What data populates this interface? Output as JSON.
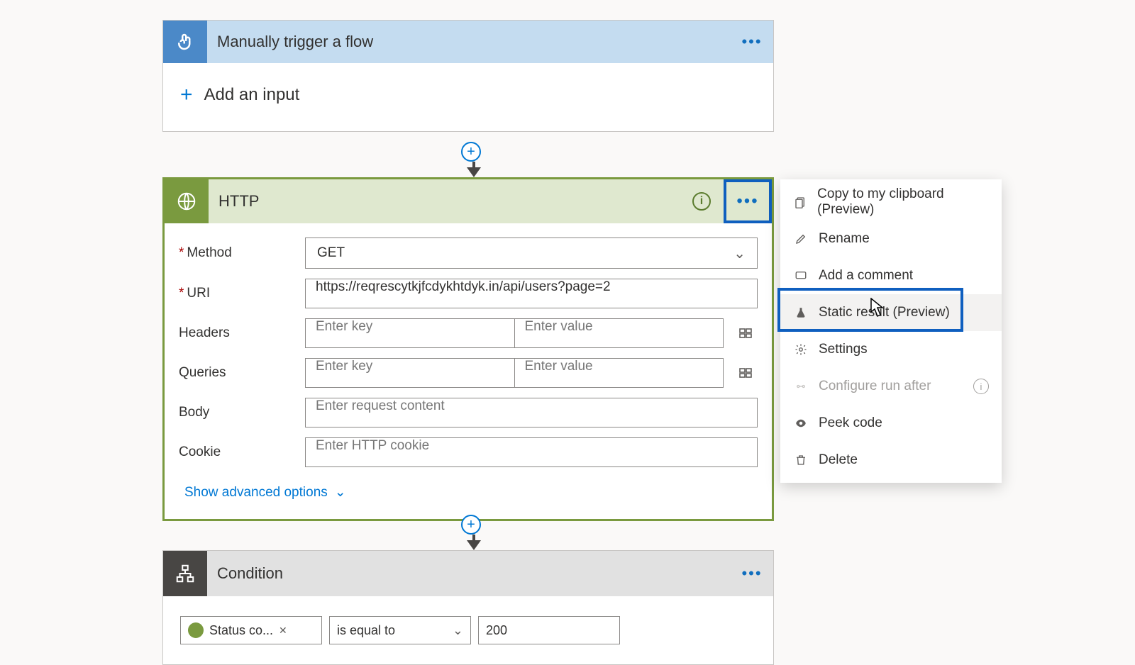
{
  "trigger": {
    "title": "Manually trigger a flow",
    "add_input_label": "Add an input"
  },
  "http": {
    "title": "HTTP",
    "labels": {
      "method": "Method",
      "uri": "URI",
      "headers": "Headers",
      "queries": "Queries",
      "body": "Body",
      "cookie": "Cookie"
    },
    "method_value": "GET",
    "uri_value": "https://reqrescytkjfcdykhtdyk.in/api/users?page=2",
    "placeholders": {
      "key": "Enter key",
      "value": "Enter value",
      "body": "Enter request content",
      "cookie": "Enter HTTP cookie"
    },
    "advanced_label": "Show advanced options"
  },
  "condition": {
    "title": "Condition",
    "field_token": "Status co...",
    "operator": "is equal to",
    "value": "200"
  },
  "menu": {
    "copy": "Copy to my clipboard (Preview)",
    "rename": "Rename",
    "comment": "Add a comment",
    "static_result": "Static result (Preview)",
    "settings": "Settings",
    "run_after": "Configure run after",
    "peek": "Peek code",
    "delete": "Delete"
  }
}
